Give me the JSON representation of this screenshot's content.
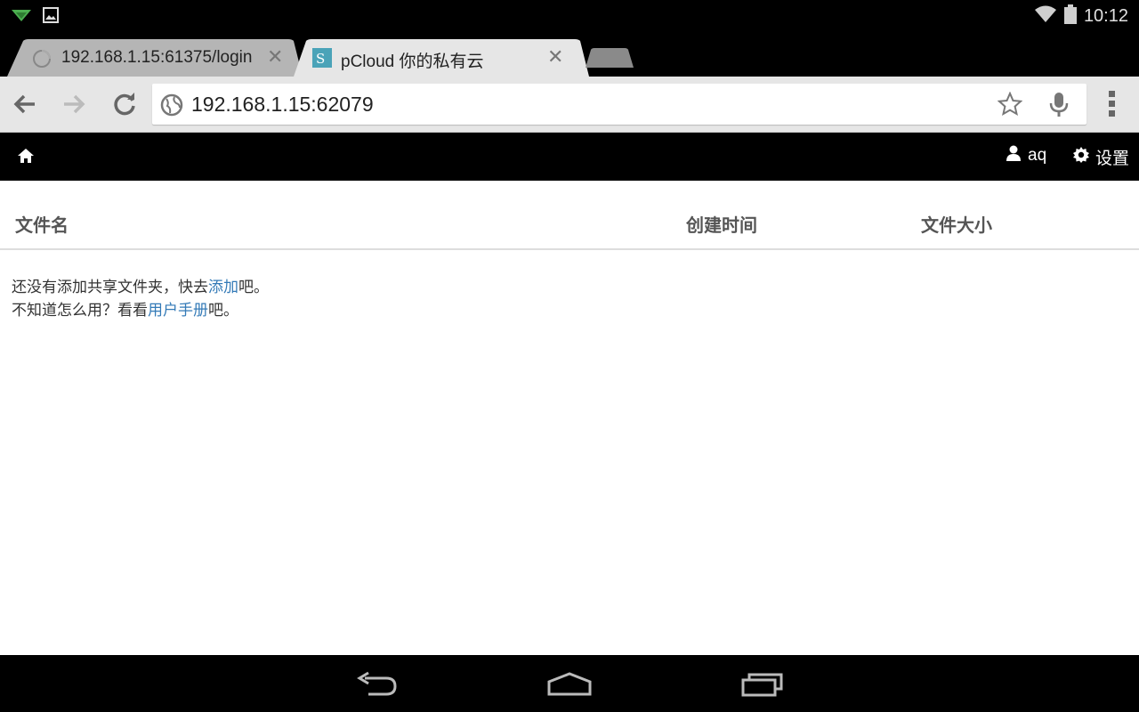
{
  "status_bar": {
    "time": "10:12",
    "icons": [
      "notification-arrow-icon",
      "image-notification-icon",
      "wifi-icon",
      "battery-icon"
    ]
  },
  "tabs": [
    {
      "title": "192.168.1.15:61375/login",
      "close": "✕",
      "state": "loading"
    },
    {
      "title": "pCloud 你的私有云",
      "close": "✕",
      "state": "active"
    }
  ],
  "toolbar": {
    "url": "192.168.1.15:62079"
  },
  "app_nav": {
    "user": "aq",
    "settings": "设置"
  },
  "table": {
    "columns": [
      "文件名",
      "创建时间",
      "文件大小"
    ]
  },
  "messages": {
    "line1_before": "还没有添加共享文件夹，快去",
    "line1_link": "添加",
    "line1_after": "吧。",
    "line2_before": "不知道怎么用？看看",
    "line2_link": "用户手册",
    "line2_after": "吧。"
  },
  "colors": {
    "link": "#337ab7",
    "nav_bg": "#000000",
    "tab_active": "#e6e6e6",
    "tab_inactive": "#b5b5b5"
  }
}
